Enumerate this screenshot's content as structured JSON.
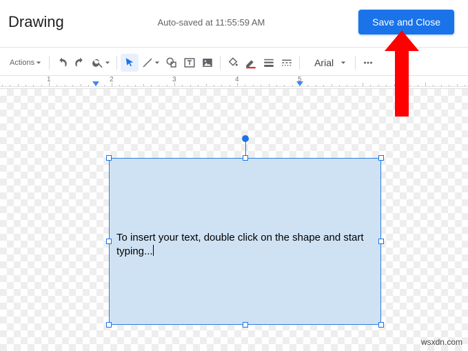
{
  "header": {
    "title": "Drawing",
    "autosave": "Auto-saved at 11:55:59 AM",
    "save_button": "Save and Close"
  },
  "toolbar": {
    "actions_label": "Actions",
    "font": "Arial"
  },
  "ruler": {
    "labels": [
      "1",
      "2",
      "3",
      "4",
      "5"
    ],
    "indent_pos_in": 1.75,
    "right_marker_in": 5.0
  },
  "shape": {
    "text": "To insert your text, double click on the shape and start typing..."
  },
  "watermark": "wsxdn.com"
}
